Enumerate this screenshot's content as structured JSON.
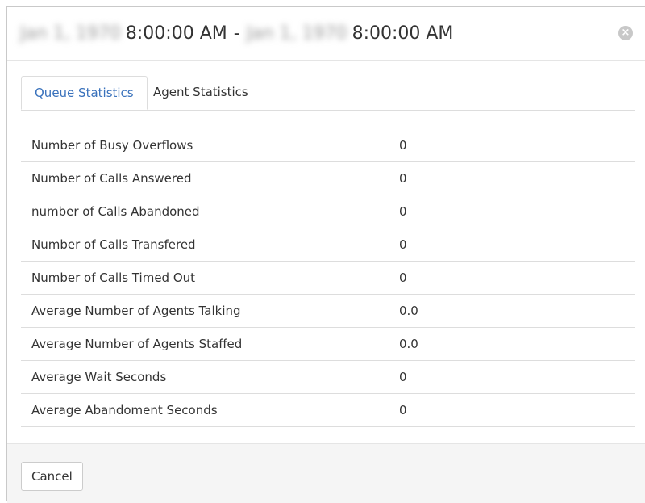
{
  "header": {
    "start_date": "Jan 1, 1970",
    "start_time": "8:00:00 AM",
    "separator": "-",
    "end_date": "Jan 1, 1970",
    "end_time": "8:00:00 AM",
    "close_icon": "close-circle-icon"
  },
  "tabs": [
    {
      "label": "Queue Statistics",
      "active": true
    },
    {
      "label": "Agent Statistics",
      "active": false
    }
  ],
  "stats": [
    {
      "label": "Number of Busy Overflows",
      "value": "0"
    },
    {
      "label": "Number of Calls Answered",
      "value": "0"
    },
    {
      "label": "number of Calls Abandoned",
      "value": "0"
    },
    {
      "label": "Number of Calls Transfered",
      "value": "0"
    },
    {
      "label": "Number of Calls Timed Out",
      "value": "0"
    },
    {
      "label": "Average Number of Agents Talking",
      "value": "0.0"
    },
    {
      "label": "Average Number of Agents Staffed",
      "value": "0.0"
    },
    {
      "label": "Average Wait Seconds",
      "value": "0"
    },
    {
      "label": "Average Abandoment Seconds",
      "value": "0"
    }
  ],
  "footer": {
    "cancel_label": "Cancel"
  },
  "colors": {
    "accent": "#3a72bc",
    "border": "#dddddd",
    "footer_bg": "#f5f5f5"
  }
}
